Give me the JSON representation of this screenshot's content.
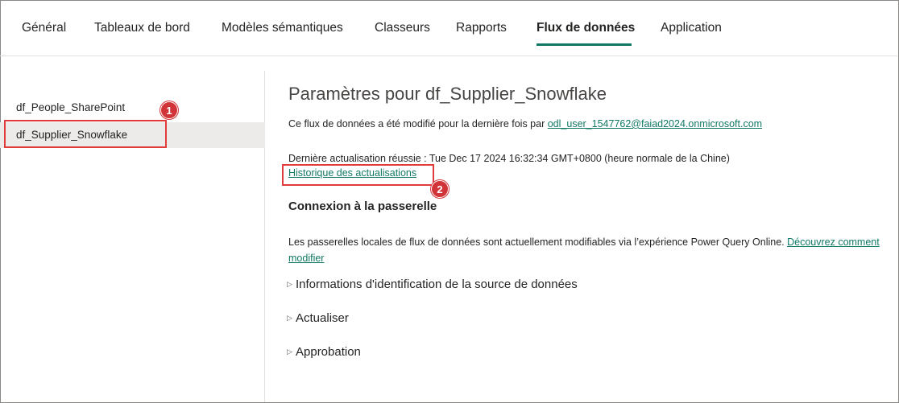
{
  "tabs": [
    {
      "label": "Général"
    },
    {
      "label": "Tableaux de bord"
    },
    {
      "label": "Modèles sémantiques"
    },
    {
      "label": "Classeurs"
    },
    {
      "label": "Rapports"
    },
    {
      "label": "Flux de données",
      "active": true
    },
    {
      "label": "Application"
    }
  ],
  "sidebar": {
    "items": [
      {
        "label": "df_People_SharePoint"
      },
      {
        "label": "df_Supplier_Snowflake",
        "selected": true
      }
    ]
  },
  "annotations": {
    "badge1": "1",
    "badge2": "2"
  },
  "settings": {
    "title": "Paramètres pour df_Supplier_Snowflake",
    "modified_prefix": "Ce flux de données a été modifié pour la dernière fois par ",
    "modified_by": "odl_user_1547762@faiad2024.onmicrosoft.com",
    "last_refresh": "Dernière actualisation réussie : Tue Dec 17 2024 16:32:34 GMT+0800 (heure normale de la Chine)",
    "history_link": "Historique des actualisations",
    "gateway_heading": "Connexion à la passerelle",
    "gateway_text": "Les passerelles locales de flux de données sont actuellement modifiables via l’expérience Power Query Online. ",
    "gateway_link": "Découvrez comment modifier",
    "sections": [
      {
        "label": "Informations d'identification de la source de données"
      },
      {
        "label": "Actualiser"
      },
      {
        "label": "Approbation"
      }
    ]
  },
  "icons": {
    "expand": "triangle-right-icon"
  },
  "colors": {
    "accent": "#117865",
    "highlight": "#e03c3c",
    "badge": "#d13438"
  }
}
